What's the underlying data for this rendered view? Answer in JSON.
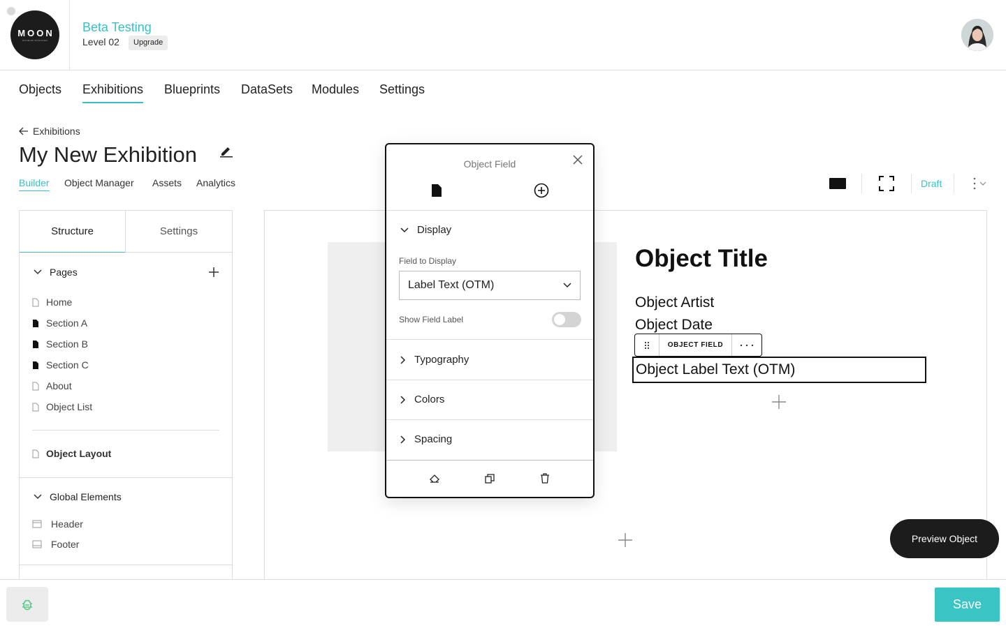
{
  "header": {
    "logo_text": "MOON",
    "logo_subtext": "MUSEUM MANAGER",
    "org_name": "Beta Testing",
    "level": "Level 02",
    "upgrade_label": "Upgrade"
  },
  "nav": {
    "items": [
      {
        "label": "Objects",
        "active": false
      },
      {
        "label": "Exhibitions",
        "active": true
      },
      {
        "label": "Blueprints",
        "active": false
      },
      {
        "label": "DataSets",
        "active": false
      },
      {
        "label": "Modules",
        "active": false
      },
      {
        "label": "Settings",
        "active": false
      }
    ]
  },
  "breadcrumb": {
    "back_label": "Exhibitions"
  },
  "page": {
    "title": "My New Exhibition"
  },
  "subtabs": {
    "items": [
      {
        "label": "Builder",
        "active": true
      },
      {
        "label": "Object Manager",
        "active": false
      },
      {
        "label": "Assets",
        "active": false
      },
      {
        "label": "Analytics",
        "active": false
      }
    ]
  },
  "toolbar": {
    "status": "Draft"
  },
  "left_panel": {
    "tabs": [
      "Structure",
      "Settings"
    ],
    "pages_heading": "Pages",
    "pages": [
      {
        "label": "Home",
        "filled": false
      },
      {
        "label": "Section A",
        "filled": true
      },
      {
        "label": "Section B",
        "filled": true
      },
      {
        "label": "Section C",
        "filled": true
      },
      {
        "label": "About",
        "filled": false
      },
      {
        "label": "Object List",
        "filled": false
      }
    ],
    "layout_item": "Object Layout",
    "global_heading": "Global Elements",
    "global_items": [
      "Header",
      "Footer"
    ]
  },
  "canvas": {
    "object_title": "Object Title",
    "object_artist": "Object Artist",
    "object_date": "Object Date",
    "field_toolbar_label": "OBJECT FIELD",
    "selected_field_text": "Object Label Text (OTM)"
  },
  "property_panel": {
    "title": "Object Field",
    "display_heading": "Display",
    "field_to_display_label": "Field to Display",
    "field_to_display_value": "Label Text (OTM)",
    "show_field_label": "Show Field Label",
    "show_field_label_on": false,
    "sections": [
      "Typography",
      "Colors",
      "Spacing"
    ]
  },
  "actions": {
    "preview_label": "Preview Object",
    "save_label": "Save"
  },
  "colors": {
    "accent": "#3bbfc4",
    "dark": "#1c1c1c"
  }
}
